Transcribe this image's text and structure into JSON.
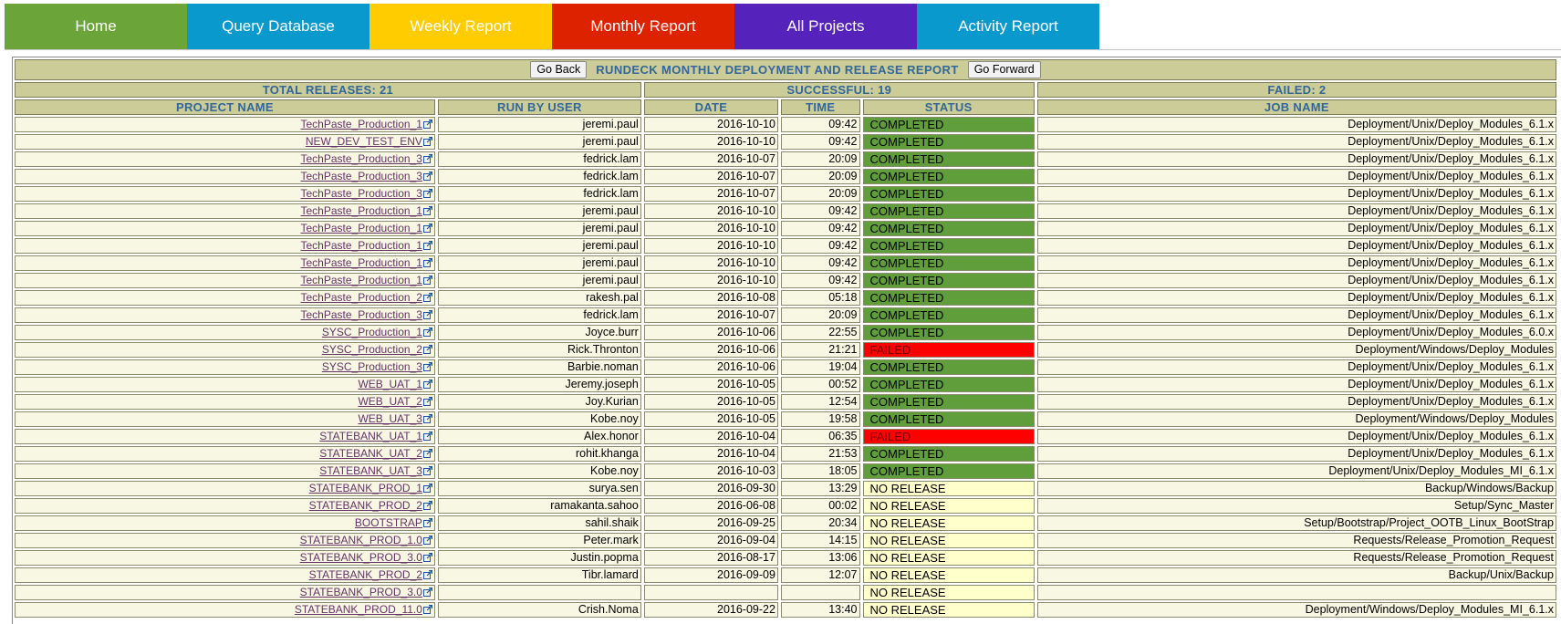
{
  "nav": {
    "tabs": [
      {
        "label": "Home",
        "color": "#6ba539"
      },
      {
        "label": "Query Database",
        "color": "#0a99cc"
      },
      {
        "label": "Weekly Report",
        "color": "#ffcc00"
      },
      {
        "label": "Monthly Report",
        "color": "#dd2200"
      },
      {
        "label": "All Projects",
        "color": "#5522bb"
      },
      {
        "label": "Activity Report",
        "color": "#0a99cc"
      }
    ]
  },
  "report": {
    "go_back": "Go Back",
    "title": "RUNDECK MONTHLY DEPLOYMENT AND RELEASE REPORT",
    "go_forward": "Go Forward",
    "total_releases": "TOTAL RELEASES: 21",
    "successful": "SUCCESSFUL: 19",
    "failed": "FAILED: 2",
    "columns": [
      "PROJECT NAME",
      "RUN BY USER",
      "DATE",
      "TIME",
      "STATUS",
      "JOB NAME"
    ],
    "rows": [
      {
        "project": "TechPaste_Production_1",
        "user": "jeremi.paul",
        "date": "2016-10-10",
        "time": "09:42",
        "status": "COMPLETED",
        "job": "Deployment/Unix/Deploy_Modules_6.1.x"
      },
      {
        "project": "NEW_DEV_TEST_ENV",
        "user": "jeremi.paul",
        "date": "2016-10-10",
        "time": "09:42",
        "status": "COMPLETED",
        "job": "Deployment/Unix/Deploy_Modules_6.1.x"
      },
      {
        "project": "TechPaste_Production_3",
        "user": "fedrick.lam",
        "date": "2016-10-07",
        "time": "20:09",
        "status": "COMPLETED",
        "job": "Deployment/Unix/Deploy_Modules_6.1.x"
      },
      {
        "project": "TechPaste_Production_3",
        "user": "fedrick.lam",
        "date": "2016-10-07",
        "time": "20:09",
        "status": "COMPLETED",
        "job": "Deployment/Unix/Deploy_Modules_6.1.x"
      },
      {
        "project": "TechPaste_Production_3",
        "user": "fedrick.lam",
        "date": "2016-10-07",
        "time": "20:09",
        "status": "COMPLETED",
        "job": "Deployment/Unix/Deploy_Modules_6.1.x"
      },
      {
        "project": "TechPaste_Production_1",
        "user": "jeremi.paul",
        "date": "2016-10-10",
        "time": "09:42",
        "status": "COMPLETED",
        "job": "Deployment/Unix/Deploy_Modules_6.1.x"
      },
      {
        "project": "TechPaste_Production_1",
        "user": "jeremi.paul",
        "date": "2016-10-10",
        "time": "09:42",
        "status": "COMPLETED",
        "job": "Deployment/Unix/Deploy_Modules_6.1.x"
      },
      {
        "project": "TechPaste_Production_1",
        "user": "jeremi.paul",
        "date": "2016-10-10",
        "time": "09:42",
        "status": "COMPLETED",
        "job": "Deployment/Unix/Deploy_Modules_6.1.x"
      },
      {
        "project": "TechPaste_Production_1",
        "user": "jeremi.paul",
        "date": "2016-10-10",
        "time": "09:42",
        "status": "COMPLETED",
        "job": "Deployment/Unix/Deploy_Modules_6.1.x"
      },
      {
        "project": "TechPaste_Production_1",
        "user": "jeremi.paul",
        "date": "2016-10-10",
        "time": "09:42",
        "status": "COMPLETED",
        "job": "Deployment/Unix/Deploy_Modules_6.1.x"
      },
      {
        "project": "TechPaste_Production_2",
        "user": "rakesh.pal",
        "date": "2016-10-08",
        "time": "05:18",
        "status": "COMPLETED",
        "job": "Deployment/Unix/Deploy_Modules_6.1.x"
      },
      {
        "project": "TechPaste_Production_3",
        "user": "fedrick.lam",
        "date": "2016-10-07",
        "time": "20:09",
        "status": "COMPLETED",
        "job": "Deployment/Unix/Deploy_Modules_6.1.x"
      },
      {
        "project": "SYSC_Production_1",
        "user": "Joyce.burr",
        "date": "2016-10-06",
        "time": "22:55",
        "status": "COMPLETED",
        "job": "Deployment/Unix/Deploy_Modules_6.0.x"
      },
      {
        "project": "SYSC_Production_2",
        "user": "Rick.Thronton",
        "date": "2016-10-06",
        "time": "21:21",
        "status": "FAILED",
        "job": "Deployment/Windows/Deploy_Modules"
      },
      {
        "project": "SYSC_Production_3",
        "user": "Barbie.noman",
        "date": "2016-10-06",
        "time": "19:04",
        "status": "COMPLETED",
        "job": "Deployment/Unix/Deploy_Modules_6.1.x"
      },
      {
        "project": "WEB_UAT_1",
        "user": "Jeremy.joseph",
        "date": "2016-10-05",
        "time": "00:52",
        "status": "COMPLETED",
        "job": "Deployment/Unix/Deploy_Modules_6.1.x"
      },
      {
        "project": "WEB_UAT_2",
        "user": "Joy.Kurian",
        "date": "2016-10-05",
        "time": "12:54",
        "status": "COMPLETED",
        "job": "Deployment/Unix/Deploy_Modules_6.1.x"
      },
      {
        "project": "WEB_UAT_3",
        "user": "Kobe.noy",
        "date": "2016-10-05",
        "time": "19:58",
        "status": "COMPLETED",
        "job": "Deployment/Windows/Deploy_Modules"
      },
      {
        "project": "STATEBANK_UAT_1",
        "user": "Alex.honor",
        "date": "2016-10-04",
        "time": "06:35",
        "status": "FAILED",
        "job": "Deployment/Unix/Deploy_Modules_6.1.x"
      },
      {
        "project": "STATEBANK_UAT_2",
        "user": "rohit.khanga",
        "date": "2016-10-04",
        "time": "21:53",
        "status": "COMPLETED",
        "job": "Deployment/Unix/Deploy_Modules_6.1.x"
      },
      {
        "project": "STATEBANK_UAT_3",
        "user": "Kobe.noy",
        "date": "2016-10-03",
        "time": "18:05",
        "status": "COMPLETED",
        "job": "Deployment/Unix/Deploy_Modules_MI_6.1.x"
      },
      {
        "project": "STATEBANK_PROD_1",
        "user": "surya.sen",
        "date": "2016-09-30",
        "time": "13:29",
        "status": "NO RELEASE",
        "job": "Backup/Windows/Backup"
      },
      {
        "project": "STATEBANK_PROD_2",
        "user": "ramakanta.sahoo",
        "date": "2016-06-08",
        "time": "00:02",
        "status": "NO RELEASE",
        "job": "Setup/Sync_Master"
      },
      {
        "project": "BOOTSTRAP",
        "user": "sahil.shaik",
        "date": "2016-09-25",
        "time": "20:34",
        "status": "NO RELEASE",
        "job": "Setup/Bootstrap/Project_OOTB_Linux_BootStrap"
      },
      {
        "project": "STATEBANK_PROD_1.0",
        "user": "Peter.mark",
        "date": "2016-09-04",
        "time": "14:15",
        "status": "NO RELEASE",
        "job": "Requests/Release_Promotion_Request"
      },
      {
        "project": "STATEBANK_PROD_3.0",
        "user": "Justin.popma",
        "date": "2016-08-17",
        "time": "13:06",
        "status": "NO RELEASE",
        "job": "Requests/Release_Promotion_Request"
      },
      {
        "project": "STATEBANK_PROD_2",
        "user": "Tibr.lamard",
        "date": "2016-09-09",
        "time": "12:07",
        "status": "NO RELEASE",
        "job": "Backup/Unix/Backup"
      },
      {
        "project": "STATEBANK_PROD_3.0",
        "user": "",
        "date": "",
        "time": "",
        "status": "NO RELEASE",
        "job": ""
      },
      {
        "project": "STATEBANK_PROD_11.0",
        "user": "Crish.Noma",
        "date": "2016-09-22",
        "time": "13:40",
        "status": "NO RELEASE",
        "job": "Deployment/Windows/Deploy_Modules_MI_6.1.x"
      }
    ]
  }
}
